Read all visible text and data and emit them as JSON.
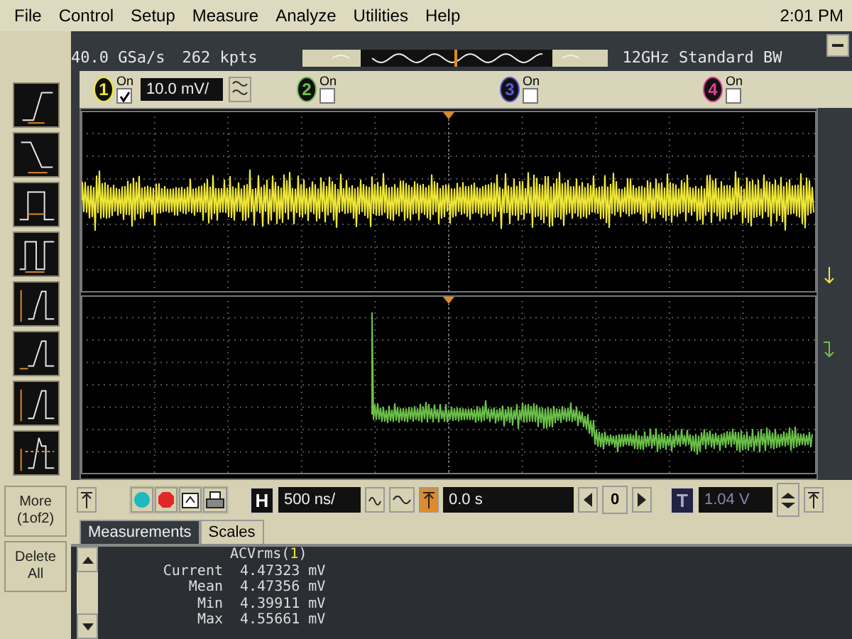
{
  "menu": [
    "File",
    "Control",
    "Setup",
    "Measure",
    "Analyze",
    "Utilities",
    "Help"
  ],
  "clock": "2:01 PM",
  "acquisition": {
    "sample_rate": "40.0 GSa/s",
    "memory_depth": "262 kpts",
    "bandwidth": "12GHz Standard BW"
  },
  "channels": [
    {
      "label": "1",
      "on_label": "On",
      "checked": true,
      "color": "#f0e836",
      "scale": "10.0 mV/"
    },
    {
      "label": "2",
      "on_label": "On",
      "checked": false,
      "color": "#6cc24a"
    },
    {
      "label": "3",
      "on_label": "On",
      "checked": false,
      "color": "#5a5ad8"
    },
    {
      "label": "4",
      "on_label": "On",
      "checked": false,
      "color": "#e0409a"
    }
  ],
  "side_buttons": [
    "More\n(1of2)",
    "Delete\nAll"
  ],
  "horizontal": {
    "label": "H",
    "scale": "500 ns/",
    "delay": "0.0 s",
    "reference": "0"
  },
  "trigger": {
    "label": "T",
    "level": "1.04 V",
    "disabled": true
  },
  "tabs": [
    {
      "label": "Measurements",
      "selected": true
    },
    {
      "label": "Scales",
      "selected": false
    }
  ],
  "measurement": {
    "title_before": "ACVrms(",
    "source": "1",
    "title_after": ")",
    "rows": [
      {
        "name": "Current",
        "value": "4.47323 mV"
      },
      {
        "name": "Mean",
        "value": "4.47356 mV"
      },
      {
        "name": "Min",
        "value": "4.39911 mV"
      },
      {
        "name": "Max",
        "value": "4.55661 mV"
      }
    ]
  }
}
